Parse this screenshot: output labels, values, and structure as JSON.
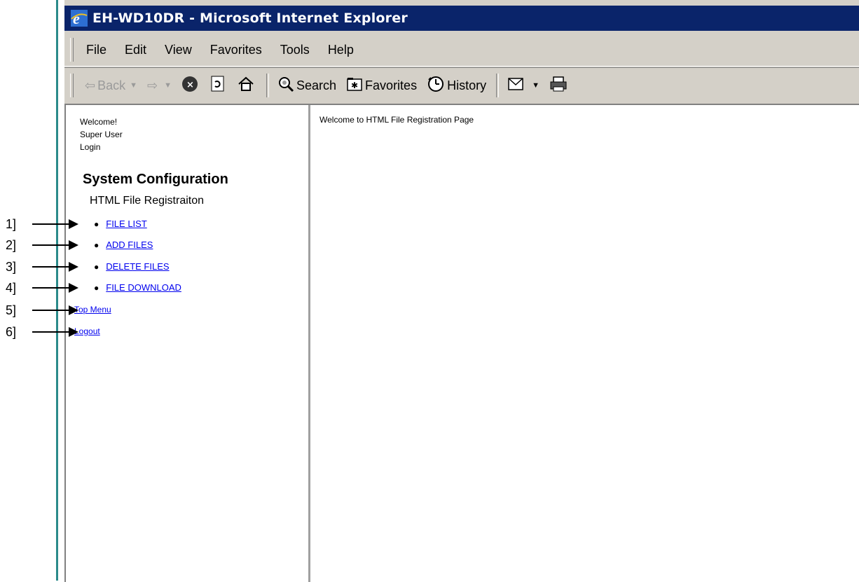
{
  "window": {
    "title": "EH-WD10DR - Microsoft Internet Explorer"
  },
  "menu": [
    "File",
    "Edit",
    "View",
    "Favorites",
    "Tools",
    "Help"
  ],
  "toolbar": {
    "back": "Back",
    "search": "Search",
    "favorites": "Favorites",
    "history": "History"
  },
  "left_frame": {
    "welcome": "Welcome!",
    "user": "Super User",
    "login": "Login",
    "section_title": "System Configuration",
    "subsection_title": "HTML File Registraiton",
    "nav": [
      {
        "label": "FILE LIST"
      },
      {
        "label": "ADD FILES"
      },
      {
        "label": "DELETE FILES"
      },
      {
        "label": "FILE DOWNLOAD"
      }
    ],
    "top_menu": "Top Menu",
    "logout": "Logout"
  },
  "right_frame": {
    "message": "Welcome to HTML File Registration Page"
  },
  "callouts": [
    "1]",
    "2]",
    "3]",
    "4]",
    "5]",
    "6]"
  ],
  "colors": {
    "titlebar": "#0a246a",
    "chrome": "#d4d0c8",
    "link": "#0000ee",
    "accent_line": "#2a8a8a"
  }
}
